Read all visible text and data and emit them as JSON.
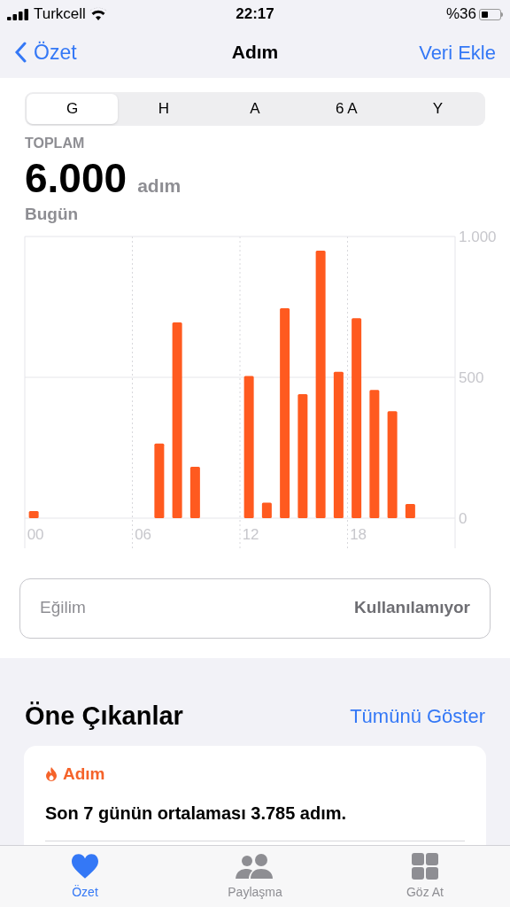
{
  "status_bar": {
    "carrier": "Turkcell",
    "time": "22:17",
    "battery": "%36"
  },
  "nav": {
    "back": "Özet",
    "title": "Adım",
    "action": "Veri Ekle"
  },
  "range_tabs": [
    {
      "label": "G",
      "selected": true
    },
    {
      "label": "H",
      "selected": false
    },
    {
      "label": "A",
      "selected": false
    },
    {
      "label": "6 A",
      "selected": false
    },
    {
      "label": "Y",
      "selected": false
    }
  ],
  "summary": {
    "label": "TOPLAM",
    "value": "6.000",
    "unit": "adım",
    "period": "Bugün"
  },
  "chart": {
    "chart_data": {
      "type": "bar",
      "x": [
        0,
        7,
        8,
        9,
        12,
        13,
        14,
        15,
        16,
        17,
        18,
        19,
        20,
        21
      ],
      "series": [
        {
          "color": "#ff5a1f",
          "values": [
            25,
            265,
            695,
            182,
            505,
            55,
            745,
            440,
            950,
            520,
            710,
            455,
            380,
            50
          ]
        }
      ],
      "xlim": [
        -0.5,
        23.5
      ],
      "ylim": [
        0,
        1000
      ],
      "yticks": [
        {
          "value": 0,
          "label": "0"
        },
        {
          "value": 500,
          "label": "500"
        },
        {
          "value": 1000,
          "label": "1.000"
        }
      ],
      "xticks": [
        {
          "value": 0,
          "label": "00"
        },
        {
          "value": 6,
          "label": "06"
        },
        {
          "value": 12,
          "label": "12"
        },
        {
          "value": 18,
          "label": "18"
        }
      ]
    }
  },
  "trend": {
    "label": "Eğilim",
    "value": "Kullanılamıyor"
  },
  "highlights": {
    "title": "Öne Çıkanlar",
    "action": "Tümünü Göster",
    "cards": [
      {
        "category": "Adım",
        "text": "Son 7 günün ortalaması 3.785 adım."
      }
    ]
  },
  "tab_bar": [
    {
      "label": "Özet",
      "selected": true
    },
    {
      "label": "Paylaşma",
      "selected": false
    },
    {
      "label": "Göz At",
      "selected": false
    }
  ]
}
